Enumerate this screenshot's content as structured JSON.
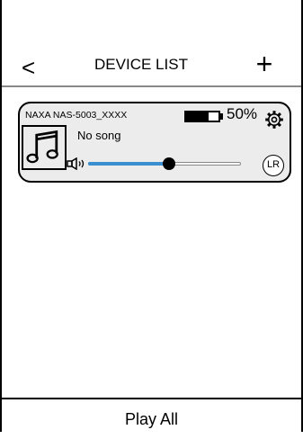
{
  "header": {
    "back_label": "<",
    "title": "DEVICE LIST",
    "add_label": "+"
  },
  "device": {
    "name": "NAXA NAS-5003_XXXX",
    "battery_percent_label": "50%",
    "battery_level": 0.7,
    "song": "No song",
    "volume_level": 0.53,
    "channel_label": "LR",
    "icons": {
      "album": "music-note-icon",
      "volume": "speaker-icon",
      "settings": "gear-icon"
    },
    "accent_color": "#3a8fd1"
  },
  "footer": {
    "play_all_label": "Play All"
  }
}
